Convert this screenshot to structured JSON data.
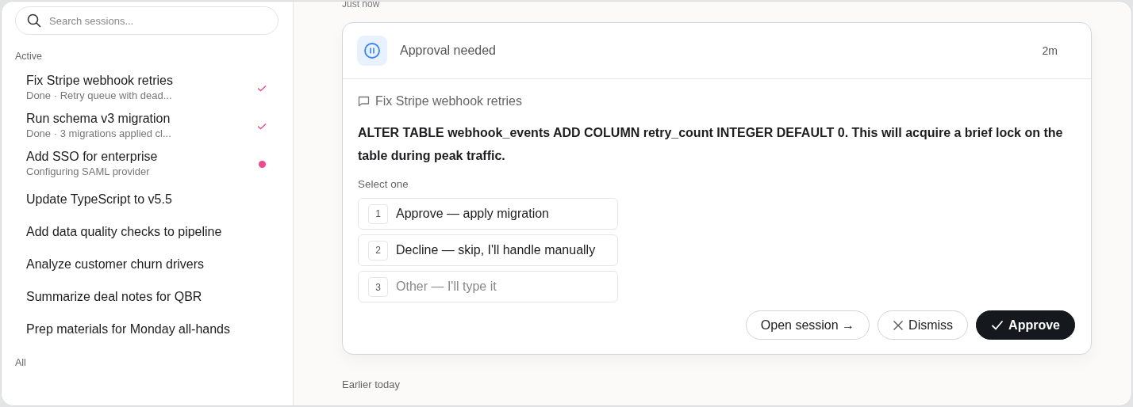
{
  "sidebar": {
    "search": {
      "placeholder": "Search sessions..."
    },
    "sections": [
      {
        "label": "Active",
        "items": [
          {
            "title": "Fix Stripe webhook retries",
            "subtitle": "Done · Retry queue with dead...",
            "kind": "done"
          },
          {
            "title": "Run schema v3 migration",
            "subtitle": "Done · 3 migrations applied cl...",
            "kind": "done"
          },
          {
            "title": "Add SSO for enterprise",
            "subtitle": "Configuring SAML provider",
            "kind": "running"
          },
          {
            "title": "Update TypeScript to v5.5",
            "kind": "plain"
          },
          {
            "title": "Add data quality checks to pipeline",
            "kind": "plain"
          },
          {
            "title": "Analyze customer churn drivers",
            "kind": "plain"
          },
          {
            "title": "Summarize deal notes for QBR",
            "kind": "plain"
          },
          {
            "title": "Prep materials for Monday all-hands",
            "kind": "plain"
          }
        ]
      },
      {
        "label": "All"
      }
    ]
  },
  "feed": {
    "top_label": "Just now",
    "card": {
      "title": "Approval needed",
      "time": "2m",
      "session": "Fix Stripe webhook retries",
      "message": "ALTER TABLE webhook_events ADD COLUMN retry_count INTEGER DEFAULT 0. This will acquire a brief lock on the table during peak traffic.",
      "prompt": "Select one",
      "options": [
        {
          "number": "1",
          "kind": "choice",
          "label": "Approve — apply migration"
        },
        {
          "number": "2",
          "kind": "choice",
          "label": "Decline — skip, I'll handle manually"
        },
        {
          "number": "3",
          "kind": "input",
          "placeholder": "Other — I'll type it"
        }
      ],
      "buttons": [
        {
          "kind": "open",
          "label": "Open session →"
        },
        {
          "kind": "dismiss",
          "label": "Dismiss"
        },
        {
          "kind": "approve",
          "label": "Approve"
        }
      ]
    },
    "bottom_label": "Earlier today"
  }
}
